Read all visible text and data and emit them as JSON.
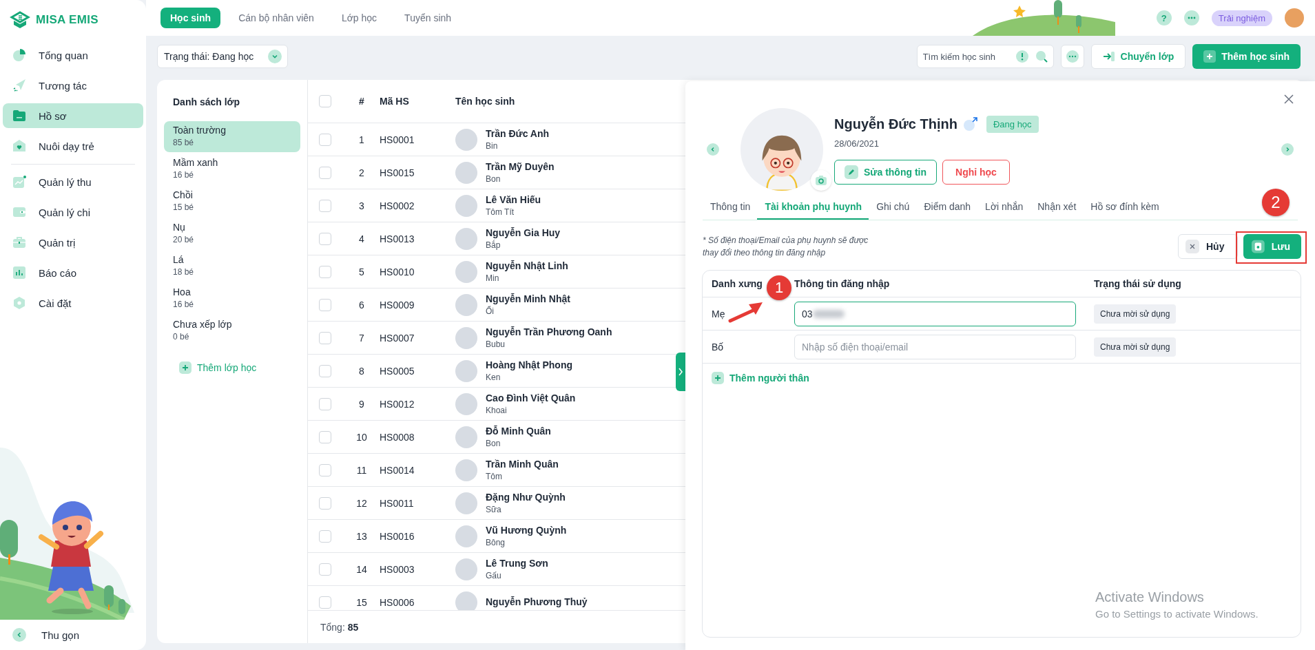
{
  "sidebar": {
    "logo": "MISA EMIS",
    "sections": [
      {
        "items": [
          {
            "label": "Tổng quan",
            "selected": false
          },
          {
            "label": "Tương tác",
            "selected": false
          },
          {
            "label": "Hồ sơ",
            "selected": true
          },
          {
            "label": "Nuôi dạy trẻ",
            "selected": false
          }
        ]
      },
      {
        "items": [
          {
            "label": "Quản lý thu",
            "selected": false
          },
          {
            "label": "Quản lý chi",
            "selected": false
          },
          {
            "label": "Quản trị",
            "selected": false
          },
          {
            "label": "Báo cáo",
            "selected": false
          },
          {
            "label": "Cài đặt",
            "selected": false
          }
        ]
      }
    ],
    "collapse": "Thu gọn"
  },
  "top_tabs": [
    {
      "label": "Học sinh",
      "selected": true
    },
    {
      "label": "Cán bộ nhân viên",
      "selected": false
    },
    {
      "label": "Lớp học",
      "selected": false
    },
    {
      "label": "Tuyển sinh",
      "selected": false
    }
  ],
  "top_actions": {
    "help": "?",
    "badge": "Trải nghiệm"
  },
  "toolbar": {
    "status_filter": "Trạng thái: Đang học",
    "search": {
      "placeholder": "Tìm kiếm học sinh"
    },
    "buttons": [
      {
        "label": "Chuyển lớp",
        "kind": "secondary"
      },
      {
        "label": "Thêm học sinh",
        "kind": "primary"
      }
    ]
  },
  "class_list": {
    "title": "Danh sách lớp",
    "items": [
      {
        "name": "Toàn trường",
        "count": "85 bé",
        "selected": true
      },
      {
        "name": "Mầm xanh",
        "count": "16 bé",
        "selected": false
      },
      {
        "name": "Chồi",
        "count": "15 bé",
        "selected": false
      },
      {
        "name": "Nụ",
        "count": "20 bé",
        "selected": false
      },
      {
        "name": "Lá",
        "count": "18 bé",
        "selected": false
      },
      {
        "name": "Hoa",
        "count": "16 bé",
        "selected": false
      },
      {
        "name": "Chưa xếp lớp",
        "count": "0 bé",
        "selected": false
      }
    ],
    "add": "Thêm lớp học"
  },
  "students": {
    "select_all_checked": false,
    "columns": [
      "#",
      "Mã HS",
      "Tên học sinh"
    ],
    "rows": [
      {
        "no": "1",
        "code": "HS0001",
        "name": "Trần Đức Anh",
        "nickname": "Bin",
        "checked": false
      },
      {
        "no": "2",
        "code": "HS0015",
        "name": "Trần Mỹ Duyên",
        "nickname": "Bon",
        "checked": false
      },
      {
        "no": "3",
        "code": "HS0002",
        "name": "Lê Văn Hiếu",
        "nickname": "Tôm Tít",
        "checked": false
      },
      {
        "no": "4",
        "code": "HS0013",
        "name": "Nguyễn Gia Huy",
        "nickname": "Bắp",
        "checked": false
      },
      {
        "no": "5",
        "code": "HS0010",
        "name": "Nguyễn Nhật Linh",
        "nickname": "Min",
        "checked": false
      },
      {
        "no": "6",
        "code": "HS0009",
        "name": "Nguyễn Minh Nhật",
        "nickname": "Ổi",
        "checked": false
      },
      {
        "no": "7",
        "code": "HS0007",
        "name": "Nguyễn Trần Phương Oanh",
        "nickname": "Bubu",
        "checked": false
      },
      {
        "no": "8",
        "code": "HS0005",
        "name": "Hoàng Nhật Phong",
        "nickname": "Ken",
        "checked": false
      },
      {
        "no": "9",
        "code": "HS0012",
        "name": "Cao Đình Việt Quân",
        "nickname": "Khoai",
        "checked": false
      },
      {
        "no": "10",
        "code": "HS0008",
        "name": "Đỗ Minh Quân",
        "nickname": "Bon",
        "checked": false
      },
      {
        "no": "11",
        "code": "HS0014",
        "name": "Trần Minh Quân",
        "nickname": "Tôm",
        "checked": false
      },
      {
        "no": "12",
        "code": "HS0011",
        "name": "Đặng Như Quỳnh",
        "nickname": "Sữa",
        "checked": false
      },
      {
        "no": "13",
        "code": "HS0016",
        "name": "Vũ Hương Quỳnh",
        "nickname": "Bông",
        "checked": false
      },
      {
        "no": "14",
        "code": "HS0003",
        "name": "Lê Trung Sơn",
        "nickname": "Gấu",
        "checked": false
      },
      {
        "no": "15",
        "code": "HS0006",
        "name": "Nguyễn Phương Thuỷ",
        "checked": false
      }
    ],
    "total_label": "Tổng:",
    "total": "85"
  },
  "detail": {
    "name": "Nguyễn Đức Thịnh",
    "status": "Đang học",
    "birth_date": "28/06/2021",
    "buttons": [
      {
        "label": "Sửa thông tin",
        "kind": "edit"
      },
      {
        "label": "Nghỉ học",
        "kind": "danger"
      }
    ],
    "tabs": [
      {
        "label": "Thông tin",
        "selected": false
      },
      {
        "label": "Tài khoản phụ huynh",
        "selected": true
      },
      {
        "label": "Ghi chú",
        "selected": false
      },
      {
        "label": "Điểm danh",
        "selected": false
      },
      {
        "label": "Lời nhắn",
        "selected": false
      },
      {
        "label": "Nhận xét",
        "selected": false
      },
      {
        "label": "Hồ sơ đính kèm",
        "selected": false
      }
    ],
    "note": "* Số điện thoại/Email của phụ huynh sẽ được thay đổi theo thông tin đăng nhập",
    "actions": [
      {
        "label": "Hủy",
        "kind": "cancel"
      },
      {
        "label": "Lưu",
        "kind": "save"
      }
    ],
    "accounts": {
      "columns": [
        "Danh xưng",
        "Thông tin đăng nhập",
        "Trạng thái sử dụng"
      ],
      "rows": [
        {
          "relation": "Mẹ",
          "login": {
            "value": "03"
          },
          "focused": true,
          "status": "Chưa mời sử dụng"
        },
        {
          "relation": "Bố",
          "login": {
            "placeholder": "Nhập số điện thoại/email"
          },
          "focused": false,
          "status": "Chưa mời sử dụng"
        }
      ]
    },
    "add_relative": "Thêm người thân"
  },
  "annotations": [
    {
      "label": "1"
    },
    {
      "label": "2"
    }
  ],
  "os_notice": {
    "title": "Activate Windows",
    "subtitle": "Go to Settings to activate Windows."
  }
}
